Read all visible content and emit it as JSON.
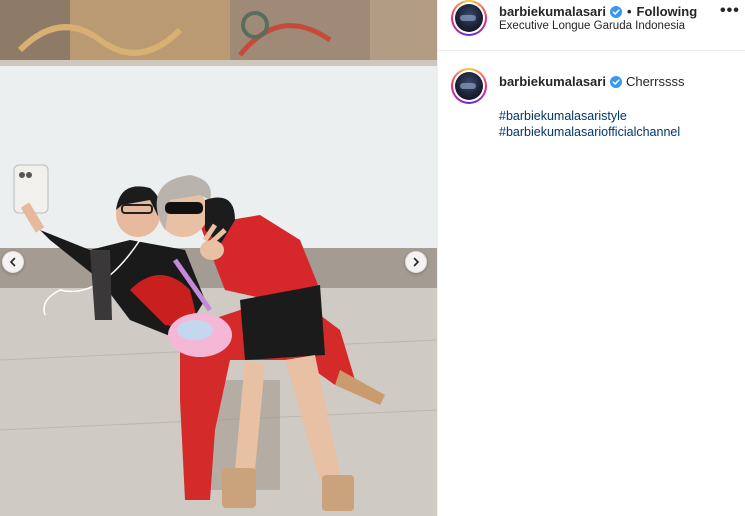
{
  "post": {
    "username": "barbiekumalasari",
    "follow_status": "Following",
    "separator": "•",
    "location": "Executive Longue Garuda Indonesia",
    "more_label": "•••",
    "caption": "Cherrssss",
    "hashtags": [
      "#barbiekumalasaristyle",
      "#barbiekumalasariofficialchannel"
    ]
  },
  "icons": {
    "verified": "verified-badge-icon",
    "prev": "chevron-left-icon",
    "next": "chevron-right-icon"
  },
  "colors": {
    "link": "#00376b",
    "verified": "#3897f0",
    "text": "#262626"
  }
}
